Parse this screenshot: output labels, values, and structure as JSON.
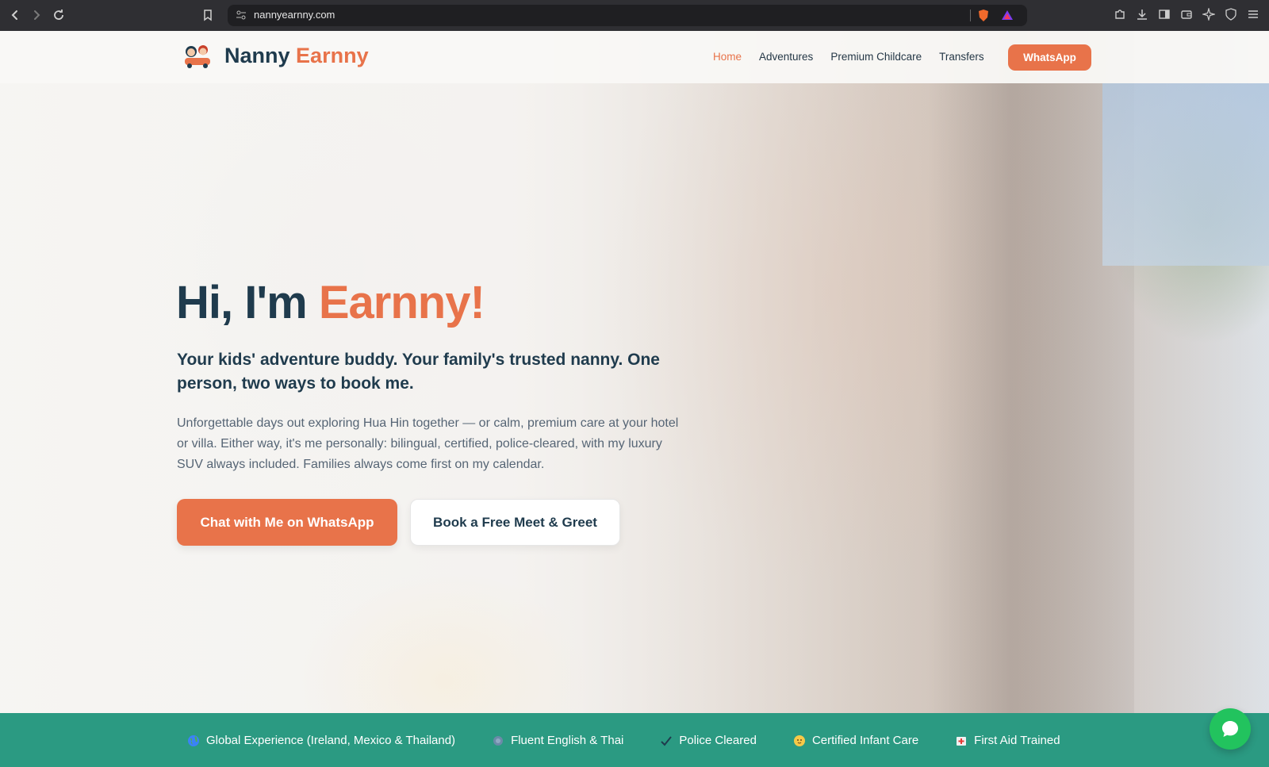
{
  "browser": {
    "url": "nannyearnny.com"
  },
  "header": {
    "logo_first": "Nanny",
    "logo_second": "Earnny",
    "nav": [
      {
        "label": "Home",
        "active": true
      },
      {
        "label": "Adventures",
        "active": false
      },
      {
        "label": "Premium Childcare",
        "active": false
      },
      {
        "label": "Transfers",
        "active": false
      }
    ],
    "cta_label": "WhatsApp"
  },
  "hero": {
    "title_prefix": "Hi, I'm ",
    "title_name": "Earnny!",
    "subtitle": "Your kids' adventure buddy. Your family's trusted nanny. One person, two ways to book me.",
    "body": "Unforgettable days out exploring Hua Hin together — or calm, premium care at your hotel or villa. Either way, it's me personally: bilingual, certified, police-cleared, with my luxury SUV always included. Families always come first on my calendar.",
    "primary_button": "Chat with Me on WhatsApp",
    "secondary_button": "Book a Free Meet & Greet"
  },
  "trust_bar": {
    "items": [
      {
        "icon": "globe-icon",
        "label": "Global Experience (Ireland, Mexico & Thailand)"
      },
      {
        "icon": "speech-icon",
        "label": "Fluent English & Thai"
      },
      {
        "icon": "check-icon",
        "label": "Police Cleared"
      },
      {
        "icon": "baby-icon",
        "label": "Certified Infant Care"
      },
      {
        "icon": "first-aid-icon",
        "label": "First Aid Trained"
      }
    ]
  },
  "colors": {
    "accent": "#e8734a",
    "navy": "#1f3b4d",
    "trust_bar": "#2b9a82",
    "whatsapp_green": "#22c35e"
  }
}
